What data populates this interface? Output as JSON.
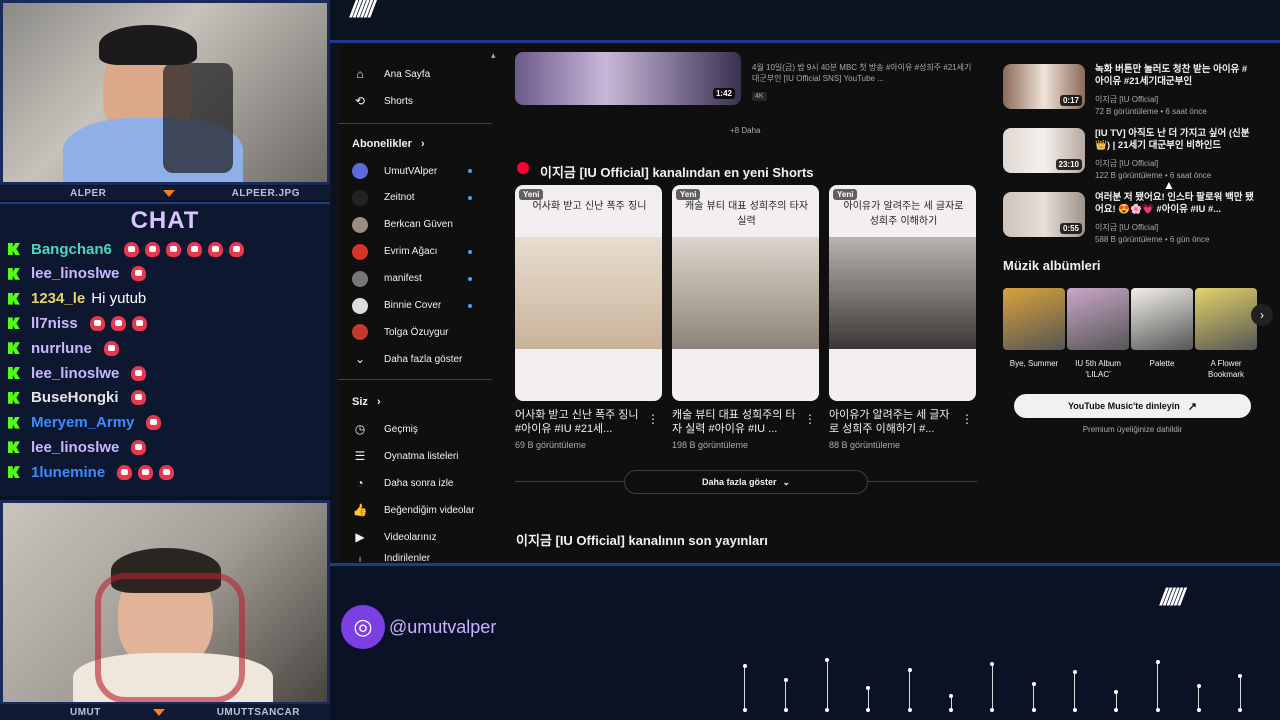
{
  "overlay": {
    "cam_top": {
      "left_name": "ALPER",
      "right_name": "ALPEER.JPG"
    },
    "cam_bottom": {
      "left_name": "UMUT",
      "right_name": "UMUTTSANCAR"
    },
    "chat_title": "CHAT",
    "chat_messages": [
      {
        "user": "Bangchan6",
        "color": "#4fd6b8",
        "text": "",
        "emotes": 6
      },
      {
        "user": "lee_linoslwe",
        "color": "#c9b8ff",
        "text": "",
        "emotes": 1
      },
      {
        "user": "1234_le",
        "color": "#e7d46b",
        "text": "Hi yutub",
        "emotes": 0
      },
      {
        "user": "ll7niss",
        "color": "#c9b8ff",
        "text": "",
        "emotes": 3
      },
      {
        "user": "nurrlune",
        "color": "#c9b8ff",
        "text": "",
        "emotes": 1
      },
      {
        "user": "lee_linoslwe",
        "color": "#c9b8ff",
        "text": "",
        "emotes": 1
      },
      {
        "user": "BuseHongki",
        "color": "#e6e6e6",
        "text": "",
        "emotes": 1
      },
      {
        "user": "Meryem_Army",
        "color": "#3b8bff",
        "text": "",
        "emotes": 1
      },
      {
        "user": "lee_linoslwe",
        "color": "#c9b8ff",
        "text": "",
        "emotes": 1
      },
      {
        "user": "1lunemine",
        "color": "#3b8bff",
        "text": "",
        "emotes": 3
      }
    ],
    "handle": "@umutvalper",
    "stripes": "//////"
  },
  "sidebar": {
    "home": "Ana Sayfa",
    "shorts": "Shorts",
    "subscriptions_heading": "Abonelikler",
    "subscriptions": [
      {
        "name": "UmutVAlper",
        "avatar": "#5b6bd8",
        "dot": true
      },
      {
        "name": "Zeitnot",
        "avatar": "#222222",
        "dot": true
      },
      {
        "name": "Berkcan Güven",
        "avatar": "#9a8d80",
        "dot": false
      },
      {
        "name": "Evrim Ağacı",
        "avatar": "#d9322b",
        "dot": true
      },
      {
        "name": "manifest",
        "avatar": "#777777",
        "dot": true
      },
      {
        "name": "Binnie Cover",
        "avatar": "#dddddd",
        "dot": true
      },
      {
        "name": "Tolga Özuygur",
        "avatar": "#c0392b",
        "dot": false
      }
    ],
    "show_more": "Daha fazla göster",
    "you_heading": "Siz",
    "you_items": [
      "Geçmiş",
      "Oynatma listeleri",
      "Daha sonra izle",
      "Beğendiğim videolar",
      "Videolarınız",
      "İndirilenler"
    ]
  },
  "main": {
    "top_video": {
      "duration": "1:42",
      "desc": "4월 10일(금) 밤 9시 40분 MBC 첫 방송 #아이유 #성희주 #21세기대군부인 [IU Official SNS] YouTube ...",
      "badge": "4K"
    },
    "more_link": "+8 Daha",
    "shorts_heading": "이지금 [IU Official] kanalından en yeni Shorts",
    "shorts": [
      {
        "caption": "어사화 받고 신난 폭주 징니",
        "badge": "Yeni",
        "title": "어사화 받고 신난 폭주 징니 #아이유 #IU #21세...",
        "views": "69 B görüntüleme"
      },
      {
        "caption": "캐술 뷰티 대표 성희주의 타자 실력",
        "badge": "Yeni",
        "title": "캐술 뷰티 대표 성희주의 타자 실력 #아이유 #IU ...",
        "views": "198 B görüntüleme"
      },
      {
        "caption": "아이유가 알려주는 세 글자로 성희주 이해하기",
        "badge": "Yeni",
        "title": "아이유가 알려주는 세 글자로 성희주 이해하기 #...",
        "views": "88 B görüntüleme"
      }
    ],
    "show_more": "Daha fazla göster",
    "latest_heading": "이지금 [IU Official] kanalının son yayınları"
  },
  "right": {
    "videos": [
      {
        "title": "녹화 버튼만 눌러도 청찬 받는 아이유 #아이유 #21세기대군부인",
        "channel": "이지금 [IU Official]",
        "meta": "72 B görüntüleme • 6 saat önce",
        "duration": "0:17"
      },
      {
        "title": "[IU TV] 아직도 난 더 가지고 싶어 (신분👑) | 21세기 대군부인 비하인드",
        "channel": "이지금 [IU Official]",
        "meta": "122 B görüntüleme • 6 saat önce",
        "duration": "23:10"
      },
      {
        "title": "여러분 저 됐어요! 인스타 팔로워 백만 됐어요! 😍🌸💗 #아이유 #IU #...",
        "channel": "이지금 [IU Official]",
        "meta": "588 B görüntüleme • 6 gün önce",
        "duration": "0:55"
      }
    ],
    "albums_heading": "Müzik albümleri",
    "albums": [
      {
        "name": "Bye, Summer",
        "color": "#d9a23a"
      },
      {
        "name": "IU 5th Album 'LILAC'",
        "color": "#c9a7c8"
      },
      {
        "name": "Palette",
        "color": "#f2efe9"
      },
      {
        "name": "A Flower Bookmark",
        "color": "#e2d36a"
      }
    ],
    "music_button": "YouTube Music'te dinleyin",
    "premium_note": "Premium üyeliğinize dahildir"
  }
}
